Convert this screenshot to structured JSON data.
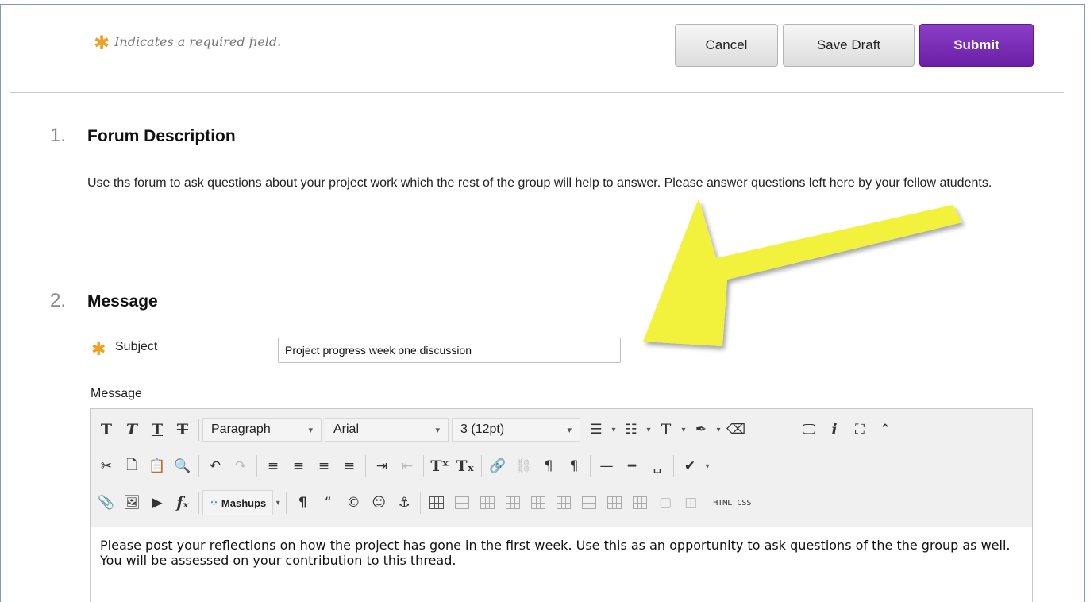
{
  "form": {
    "required_note": "Indicates a required field.",
    "buttons": {
      "cancel": "Cancel",
      "save_draft": "Save Draft",
      "submit": "Submit"
    }
  },
  "section1": {
    "number": "1.",
    "title": "Forum Description",
    "description": "Use ths forum to ask questions about your project work which the rest of the group will help to answer. Please answer questions left here by your fellow atudents."
  },
  "section2": {
    "number": "2.",
    "title": "Message",
    "subject_label": "Subject",
    "subject_value": "Project progress week one discussion",
    "message_label": "Message"
  },
  "editor": {
    "format_select": "Paragraph",
    "font_select": "Arial",
    "size_select": "3 (12pt)",
    "mashups_label": "Mashups",
    "html_label": "HTML",
    "css_label": "CSS",
    "content": "Please post your reflections on how the project has gone in the first week. Use this as an opportunity to ask questions of the the group as well. You will be assessed on your contribution to this thread."
  },
  "colors": {
    "required_star": "#f0a020",
    "submit_button": "#7a2fb8",
    "annotation_arrow": "#f2f23c"
  }
}
